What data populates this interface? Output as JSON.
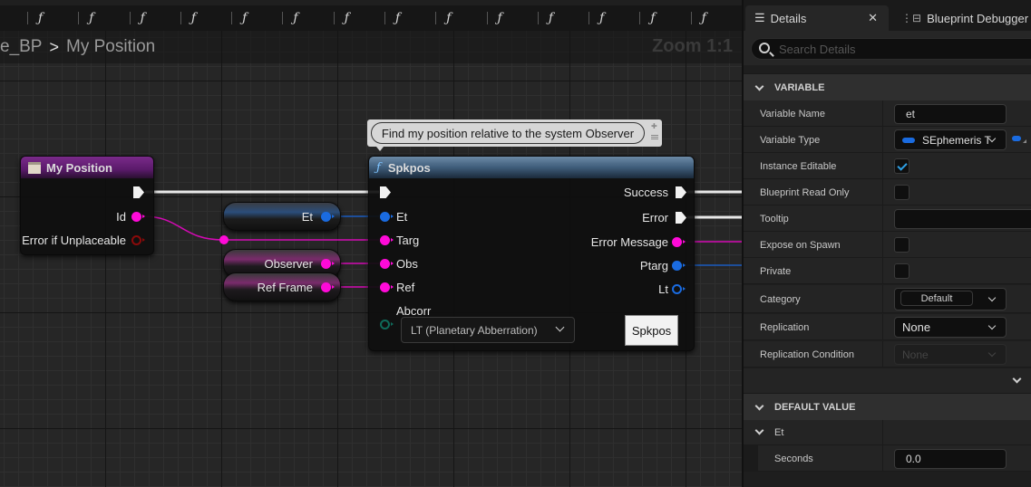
{
  "graph": {
    "function_tabs": [
      "ƒ",
      "ƒ",
      "ƒ",
      "ƒ",
      "ƒ",
      "ƒ",
      "ƒ",
      "ƒ",
      "ƒ",
      "ƒ",
      "ƒ",
      "ƒ",
      "ƒ",
      "ƒ"
    ],
    "breadcrumb": {
      "parent": "e_BP",
      "separator": ">",
      "current": "My Position"
    },
    "zoom_label": "Zoom 1:1",
    "comment": "Find my position relative to the system Observer",
    "entry_node": {
      "title": "My Position",
      "outputs": [
        {
          "label": "Id",
          "type": "pink"
        },
        {
          "label": "Error if Unplaceable",
          "type": "hollow-red"
        }
      ]
    },
    "variable_nodes": [
      {
        "label": "Et",
        "color": "blue"
      },
      {
        "label": "Observer",
        "color": "pink"
      },
      {
        "label": "Ref Frame",
        "color": "pink"
      }
    ],
    "function_node": {
      "icon": "ƒ",
      "title": "Spkpos",
      "inputs": [
        {
          "label": "Et",
          "type": "blue"
        },
        {
          "label": "Targ",
          "type": "pink"
        },
        {
          "label": "Obs",
          "type": "pink"
        },
        {
          "label": "Ref",
          "type": "pink"
        },
        {
          "label": "Abcorr",
          "type": "hollow-teal"
        }
      ],
      "outputs": [
        {
          "label": "Success",
          "type": "exec"
        },
        {
          "label": "Error",
          "type": "exec"
        },
        {
          "label": "Error Message",
          "type": "pink"
        },
        {
          "label": "Ptarg",
          "type": "blue"
        },
        {
          "label": "Lt",
          "type": "hollow-blue"
        }
      ],
      "abcorr_value": "LT (Planetary Abberration)",
      "button_label": "Spkpos"
    },
    "colors": {
      "string_pin": "#ff0ad8",
      "struct_pin": "#1a6be0",
      "exec": "#f2f2f2"
    }
  },
  "details": {
    "tabs": [
      {
        "label": "Details",
        "active": true
      },
      {
        "label": "Blueprint Debugger",
        "active": false
      }
    ],
    "search_placeholder": "Search Details",
    "variable_section": {
      "title": "VARIABLE",
      "variable_name_label": "Variable Name",
      "variable_name_value": "et",
      "variable_type_label": "Variable Type",
      "variable_type_value": "SEphemeris T",
      "instance_editable_label": "Instance Editable",
      "instance_editable": true,
      "blueprint_read_only_label": "Blueprint Read Only",
      "blueprint_read_only": false,
      "tooltip_label": "Tooltip",
      "tooltip_value": "",
      "expose_on_spawn_label": "Expose on Spawn",
      "expose_on_spawn": false,
      "private_label": "Private",
      "private": false,
      "category_label": "Category",
      "category_value": "Default",
      "replication_label": "Replication",
      "replication_value": "None",
      "replication_condition_label": "Replication Condition",
      "replication_condition_value": "None"
    },
    "default_value_section": {
      "title": "DEFAULT VALUE",
      "struct_label": "Et",
      "seconds_label": "Seconds",
      "seconds_value": "0.0"
    }
  }
}
